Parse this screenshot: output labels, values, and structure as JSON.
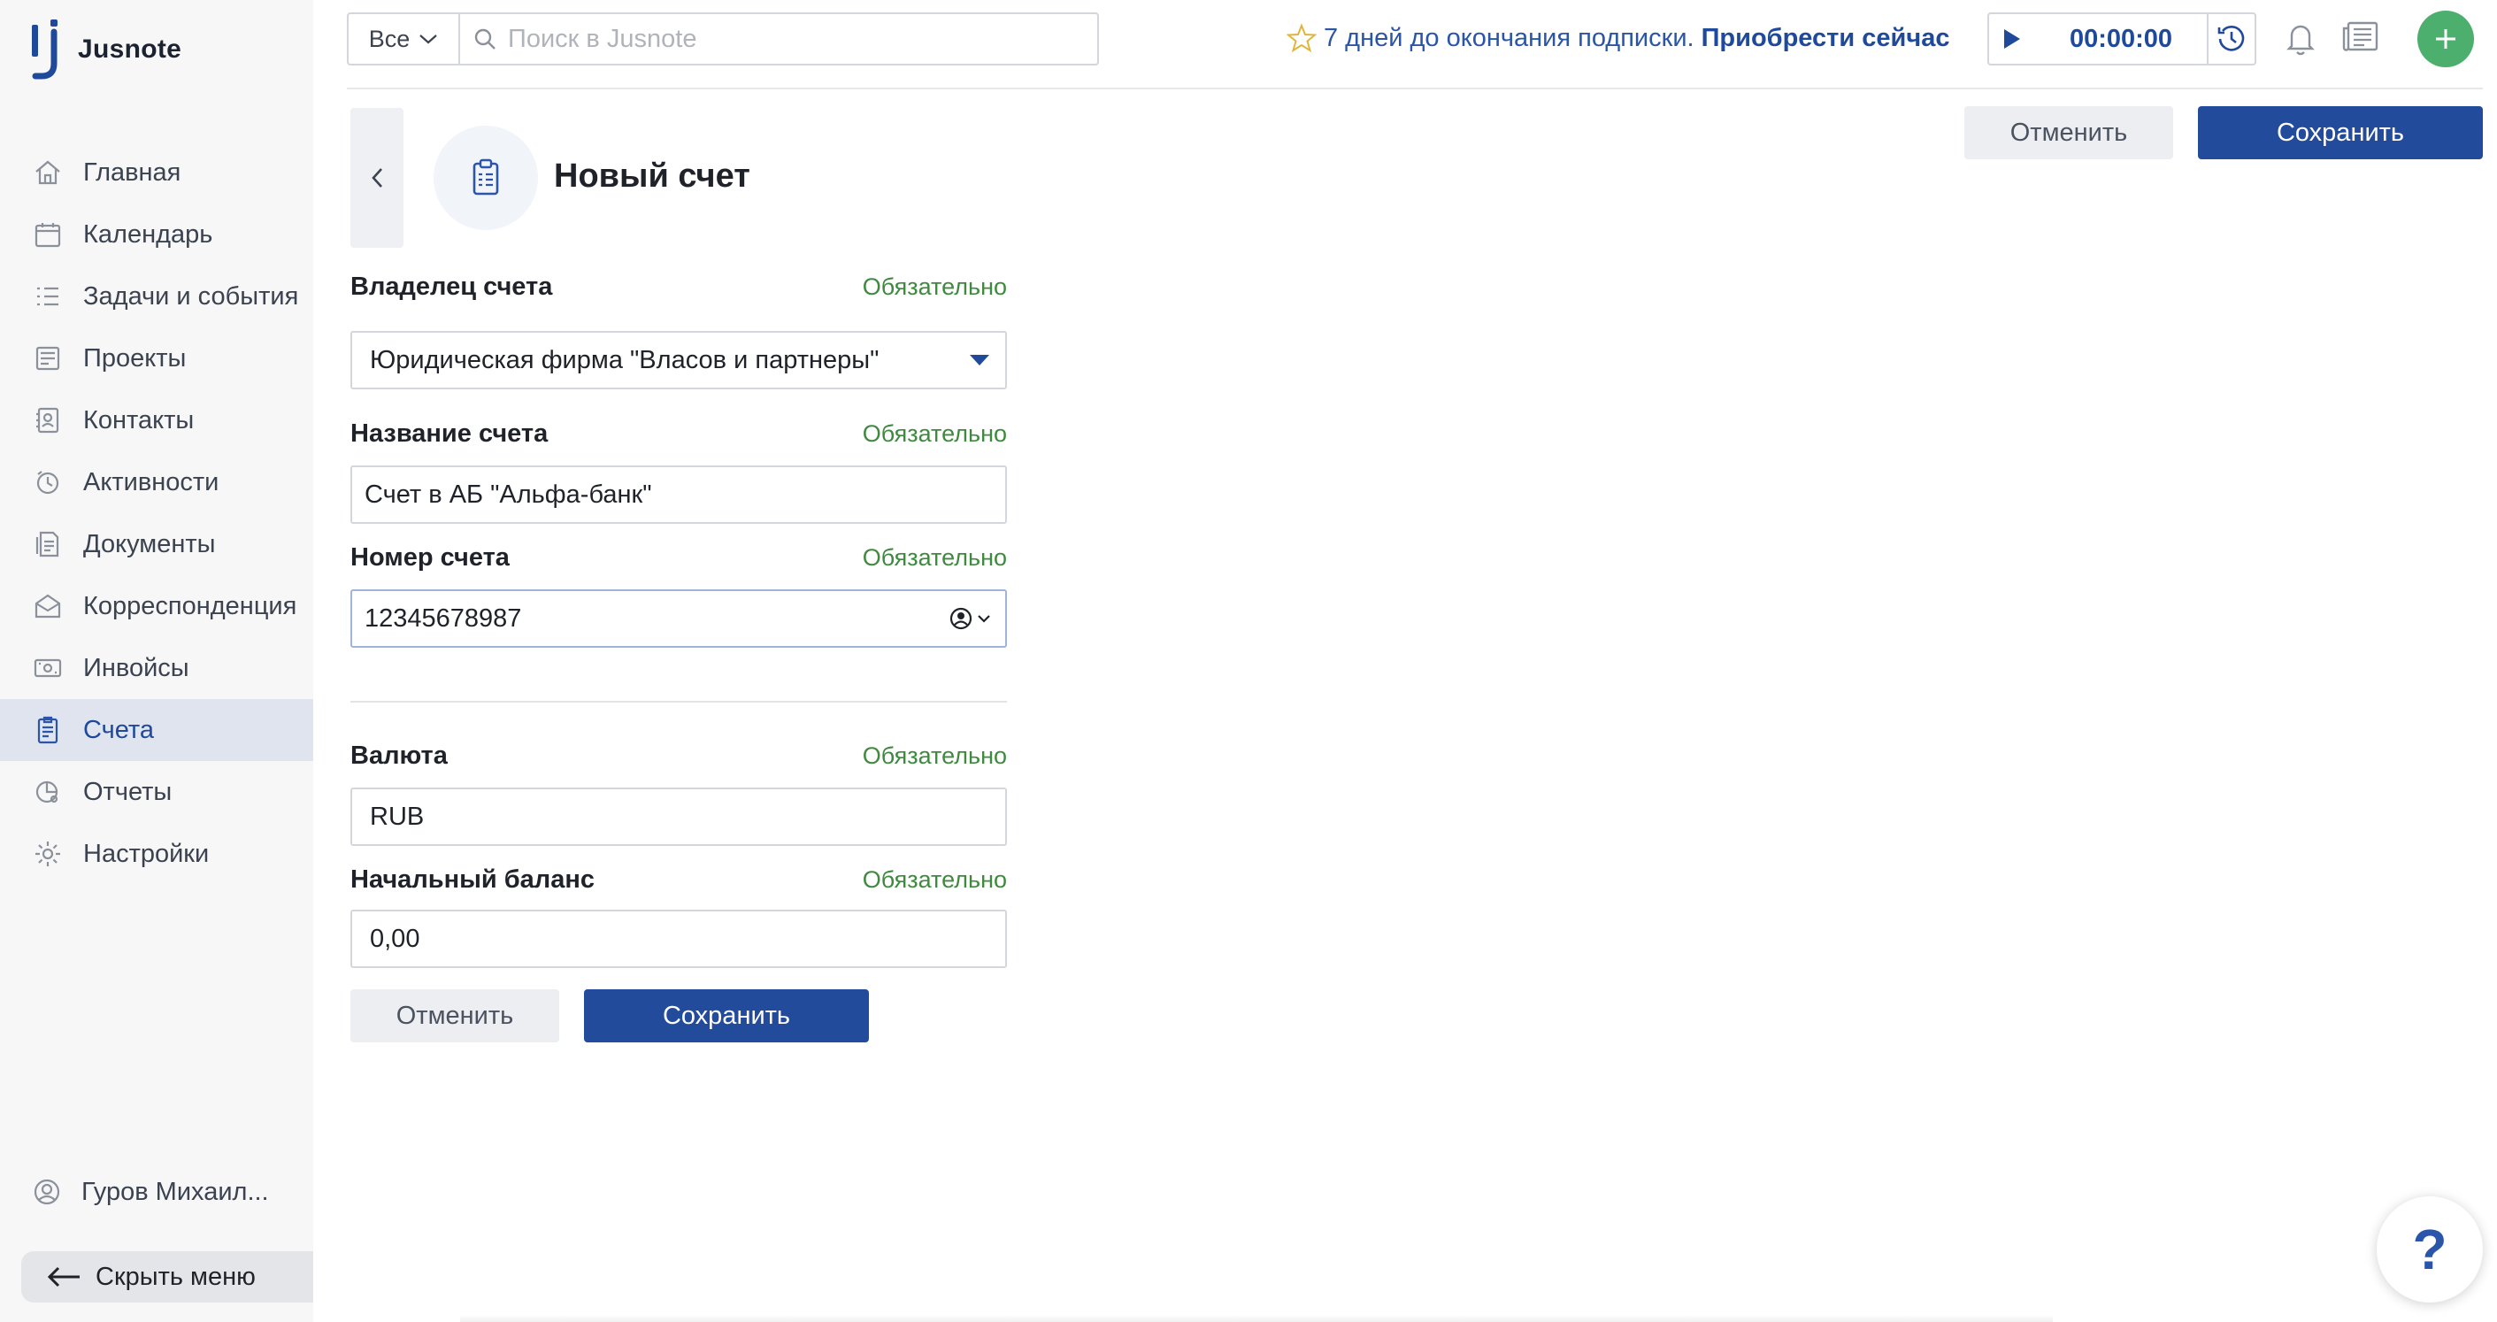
{
  "app": {
    "name": "Jusnote"
  },
  "sidebar": {
    "items": [
      {
        "label": "Главная",
        "icon": "home-icon"
      },
      {
        "label": "Календарь",
        "icon": "calendar-icon"
      },
      {
        "label": "Задачи и события",
        "icon": "tasks-icon"
      },
      {
        "label": "Проекты",
        "icon": "projects-icon"
      },
      {
        "label": "Контакты",
        "icon": "contacts-icon"
      },
      {
        "label": "Активности",
        "icon": "activity-icon"
      },
      {
        "label": "Документы",
        "icon": "documents-icon"
      },
      {
        "label": "Корреспонденция",
        "icon": "correspondence-icon"
      },
      {
        "label": "Инвойсы",
        "icon": "invoices-icon"
      },
      {
        "label": "Счета",
        "icon": "accounts-icon",
        "active": true
      },
      {
        "label": "Отчеты",
        "icon": "reports-icon"
      },
      {
        "label": "Настройки",
        "icon": "settings-icon"
      }
    ],
    "user": "Гуров Михаил...",
    "hide_menu": "Скрыть меню"
  },
  "topbar": {
    "scope": "Все",
    "search_placeholder": "Поиск в Jusnote",
    "subscription_text": "7 дней до окончания подписки.",
    "subscription_link": "Приобрести сейчас",
    "timer": "00:00:00"
  },
  "header": {
    "title": "Новый счет",
    "cancel": "Отменить",
    "save": "Сохранить"
  },
  "form": {
    "required_label": "Обязательно",
    "owner": {
      "label": "Владелец счета",
      "value": "Юридическая фирма \"Власов и партнеры\""
    },
    "name": {
      "label": "Название счета",
      "value": "Счет в АБ \"Альфа-банк\""
    },
    "number": {
      "label": "Номер счета",
      "value": "12345678987"
    },
    "currency": {
      "label": "Валюта",
      "value": "RUB"
    },
    "balance": {
      "label": "Начальный баланс",
      "value": "0,00"
    },
    "cancel": "Отменить",
    "save": "Сохранить"
  },
  "help": {
    "label": "?"
  },
  "colors": {
    "accent": "#234b9c",
    "link": "#2a55a8",
    "required": "#3f8a3f",
    "add_button": "#4caf6e",
    "sidebar_active": "#dfe4ee"
  }
}
